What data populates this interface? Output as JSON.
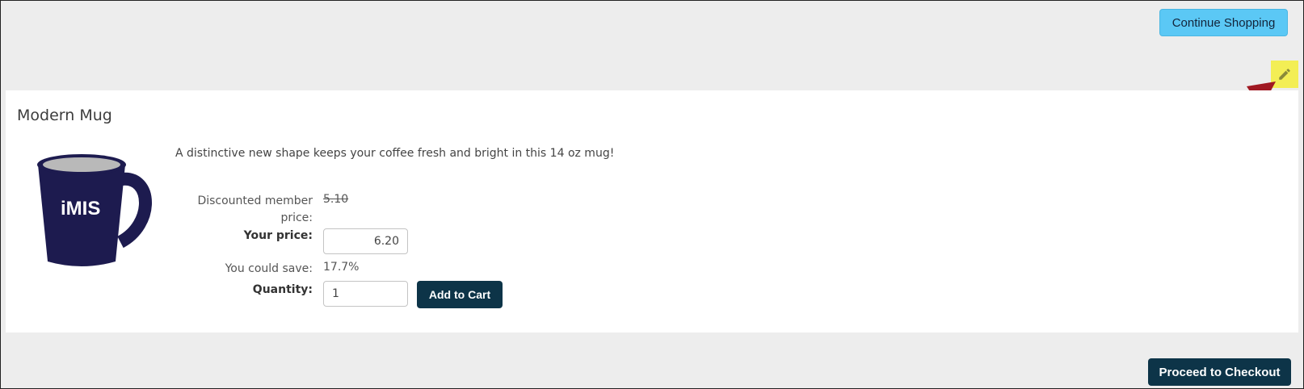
{
  "header": {
    "continue_label": "Continue Shopping"
  },
  "edit": {
    "icon": "pencil-icon",
    "highlight_color": "#f3ee55"
  },
  "annotation": {
    "arrow_color": "#a01822"
  },
  "product": {
    "title": "Modern Mug",
    "description": "A distinctive new shape keeps your coffee fresh and bright in this 14 oz mug!",
    "image": {
      "logo_text": "iMIS",
      "mug_color": "#1d1b4f"
    },
    "discount_label_line1": "Discounted member",
    "discount_label_line2": "price:",
    "discount_price": "5.10",
    "your_price_label": "Your price:",
    "your_price_value": "6.20",
    "save_label": "You could save:",
    "save_value": "17.7%",
    "quantity_label": "Quantity:",
    "quantity_value": "1",
    "add_to_cart_label": "Add to Cart"
  },
  "footer": {
    "checkout_label": "Proceed to Checkout"
  },
  "colors": {
    "primary": "#0d3448",
    "accent": "#5bc8f5",
    "background": "#ededed"
  }
}
